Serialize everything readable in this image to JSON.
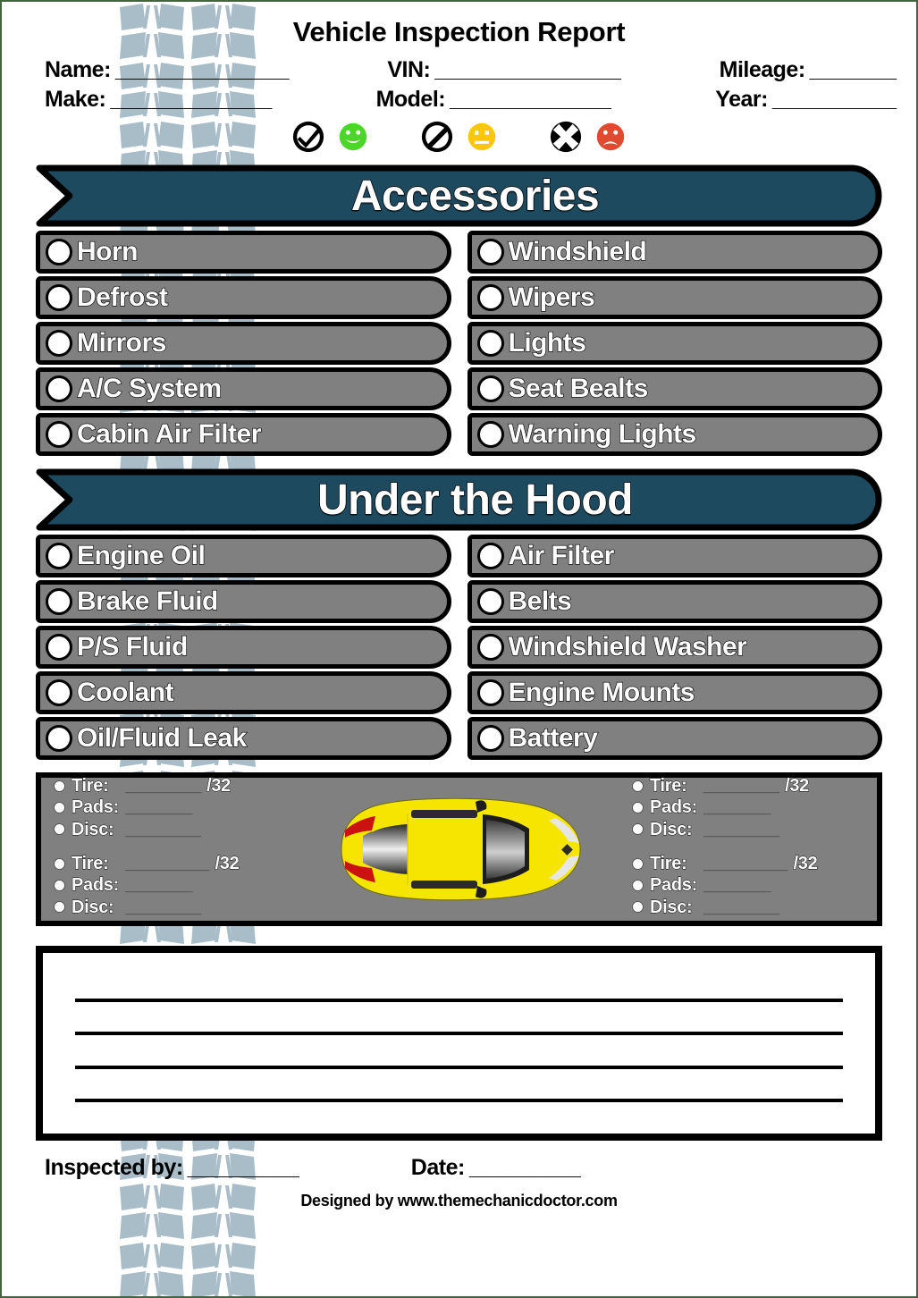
{
  "page": {
    "title": "Vehicle Inspection Report",
    "border_color": "#44643f",
    "banner_color": "#1d4a5e",
    "row_fill_color": "#808080",
    "watermark_color": "#a9bdc9"
  },
  "header": {
    "fields": [
      {
        "label": "Name:",
        "blank": "______________"
      },
      {
        "label": "VIN:",
        "blank": "_______________"
      },
      {
        "label": "Mileage:",
        "blank": "_______"
      },
      {
        "label": "Make:",
        "blank": "_____________"
      },
      {
        "label": "Model:",
        "blank": "_____________"
      },
      {
        "label": "Year:",
        "blank": "__________"
      }
    ]
  },
  "legend": {
    "items": [
      {
        "mark": "check-circle-icon",
        "face": "smiley-happy-icon",
        "face_color": "#4dd62a",
        "meaning": "good"
      },
      {
        "mark": "slash-circle-icon",
        "face": "smiley-neutral-icon",
        "face_color": "#fcc60a",
        "meaning": "caution"
      },
      {
        "mark": "x-circle-icon",
        "face": "smiley-sad-icon",
        "face_color": "#e04a2f",
        "meaning": "bad"
      }
    ]
  },
  "sections": [
    {
      "title": "Accessories",
      "left_items": [
        "Horn",
        "Defrost",
        "Mirrors",
        "A/C System",
        "Cabin Air Filter"
      ],
      "right_items": [
        "Windshield",
        "Wipers",
        "Lights",
        "Seat Bealts",
        "Warning Lights"
      ]
    },
    {
      "title": "Under the Hood",
      "left_items": [
        "Engine Oil",
        "Brake Fluid",
        "P/S Fluid",
        "Coolant",
        "Oil/Fluid Leak"
      ],
      "right_items": [
        "Air Filter",
        "Belts",
        "Windshield Washer",
        "Engine Mounts",
        "Battery"
      ]
    }
  ],
  "tire_panel": {
    "corners": [
      {
        "position": "front-left",
        "lines": [
          {
            "key": "Tire:",
            "blank": "_________",
            "unit": "/32"
          },
          {
            "key": "Pads:",
            "blank": "________",
            "unit": ""
          },
          {
            "key": "Disc:",
            "blank": "_________",
            "unit": ""
          }
        ]
      },
      {
        "position": "rear-left",
        "lines": [
          {
            "key": "Tire:",
            "blank": "__________",
            "unit": "/32"
          },
          {
            "key": "Pads:",
            "blank": "________",
            "unit": ""
          },
          {
            "key": "Disc:",
            "blank": "_________",
            "unit": ""
          }
        ]
      },
      {
        "position": "front-right",
        "lines": [
          {
            "key": "Tire:",
            "blank": "_________",
            "unit": "/32"
          },
          {
            "key": "Pads:",
            "blank": "________",
            "unit": ""
          },
          {
            "key": "Disc:",
            "blank": "_________",
            "unit": ""
          }
        ]
      },
      {
        "position": "rear-right",
        "lines": [
          {
            "key": "Tire:",
            "blank": "__________",
            "unit": "/32"
          },
          {
            "key": "Pads:",
            "blank": "________",
            "unit": ""
          },
          {
            "key": "Disc:",
            "blank": "_________",
            "unit": ""
          }
        ]
      }
    ],
    "car_illustration": "car-top-view-icon",
    "car_color": "#f6e500"
  },
  "notes": {
    "line_count": 4
  },
  "footer": {
    "inspected_label": "Inspected by:",
    "inspected_blank": "_________",
    "date_label": "Date:",
    "date_blank": "_________",
    "credit": "Designed by www.themechanicdoctor.com"
  }
}
